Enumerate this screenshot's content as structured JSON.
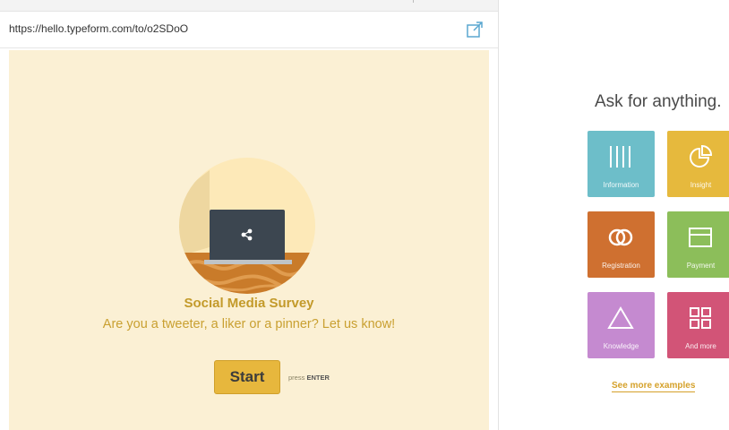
{
  "browser": {
    "url": "https://hello.typeform.com/to/o2SDoO"
  },
  "form": {
    "title": "Social Media Survey",
    "subtitle": "Are you a tweeter, a liker or a pinner? Let us know!",
    "start_label": "Start",
    "press_hint": "press",
    "press_key": "ENTER",
    "colors": {
      "background": "#fbf0d4",
      "accent": "#e7b73d",
      "title": "#c39a2a"
    }
  },
  "panel": {
    "heading": "Ask for anything.",
    "tiles": [
      {
        "label": "Information",
        "color": "#6dbec9",
        "icon": "bars-icon"
      },
      {
        "label": "Insight",
        "color": "#e6b93d",
        "icon": "pie-chart-icon"
      },
      {
        "label": "Registration",
        "color": "#cf7030",
        "icon": "rings-icon"
      },
      {
        "label": "Payment",
        "color": "#8cbe5a",
        "icon": "card-icon"
      },
      {
        "label": "Knowledge",
        "color": "#c58ad0",
        "icon": "triangle-icon"
      },
      {
        "label": "And more",
        "color": "#d25477",
        "icon": "grid-icon"
      }
    ],
    "see_more": "See more examples"
  }
}
